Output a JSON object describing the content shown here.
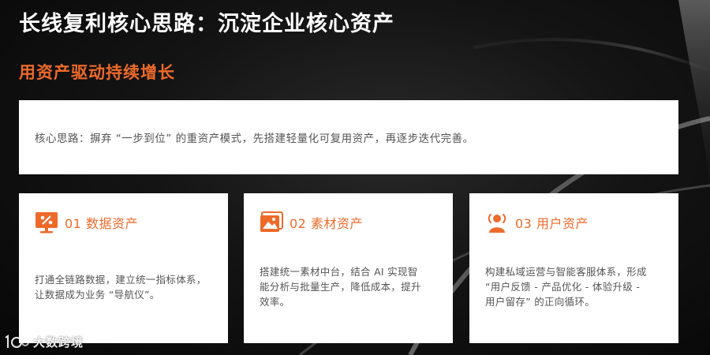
{
  "title": "长线复利核心思路：沉淀企业核心资产",
  "subtitle": "用资产驱动持续增长",
  "core": {
    "text": "核心思路：摒弃 “一步到位” 的重资产模式，先搭建轻量化可复用资产，再逐步迭代完善。"
  },
  "cards": [
    {
      "title": "01 数据资产",
      "icon": "chart-screen-icon",
      "lines": [
        "打通全链路数据，建立统一指标体系，",
        "让数据成为业务 “导航仪”。"
      ]
    },
    {
      "title": "02 素材资产",
      "icon": "image-gallery-icon",
      "lines": [
        "搭建统一素材中台，结合 AI 实现智",
        "能分析与批量生产，降低成本，提升",
        "效率。"
      ]
    },
    {
      "title": "03 用户资产",
      "icon": "user-broadcast-icon",
      "lines": [
        "构建私域运营与智能客服体系，形成",
        "“用户反馈 - 产品优化 - 体验升级 -",
        "用户留存” 的正向循环。"
      ]
    }
  ],
  "watermark": {
    "text": "大数跨境"
  },
  "colors": {
    "accent": "#ee6a2a",
    "card_bg": "#ffffff",
    "text_body": "#555555",
    "title": "#ffffff"
  }
}
